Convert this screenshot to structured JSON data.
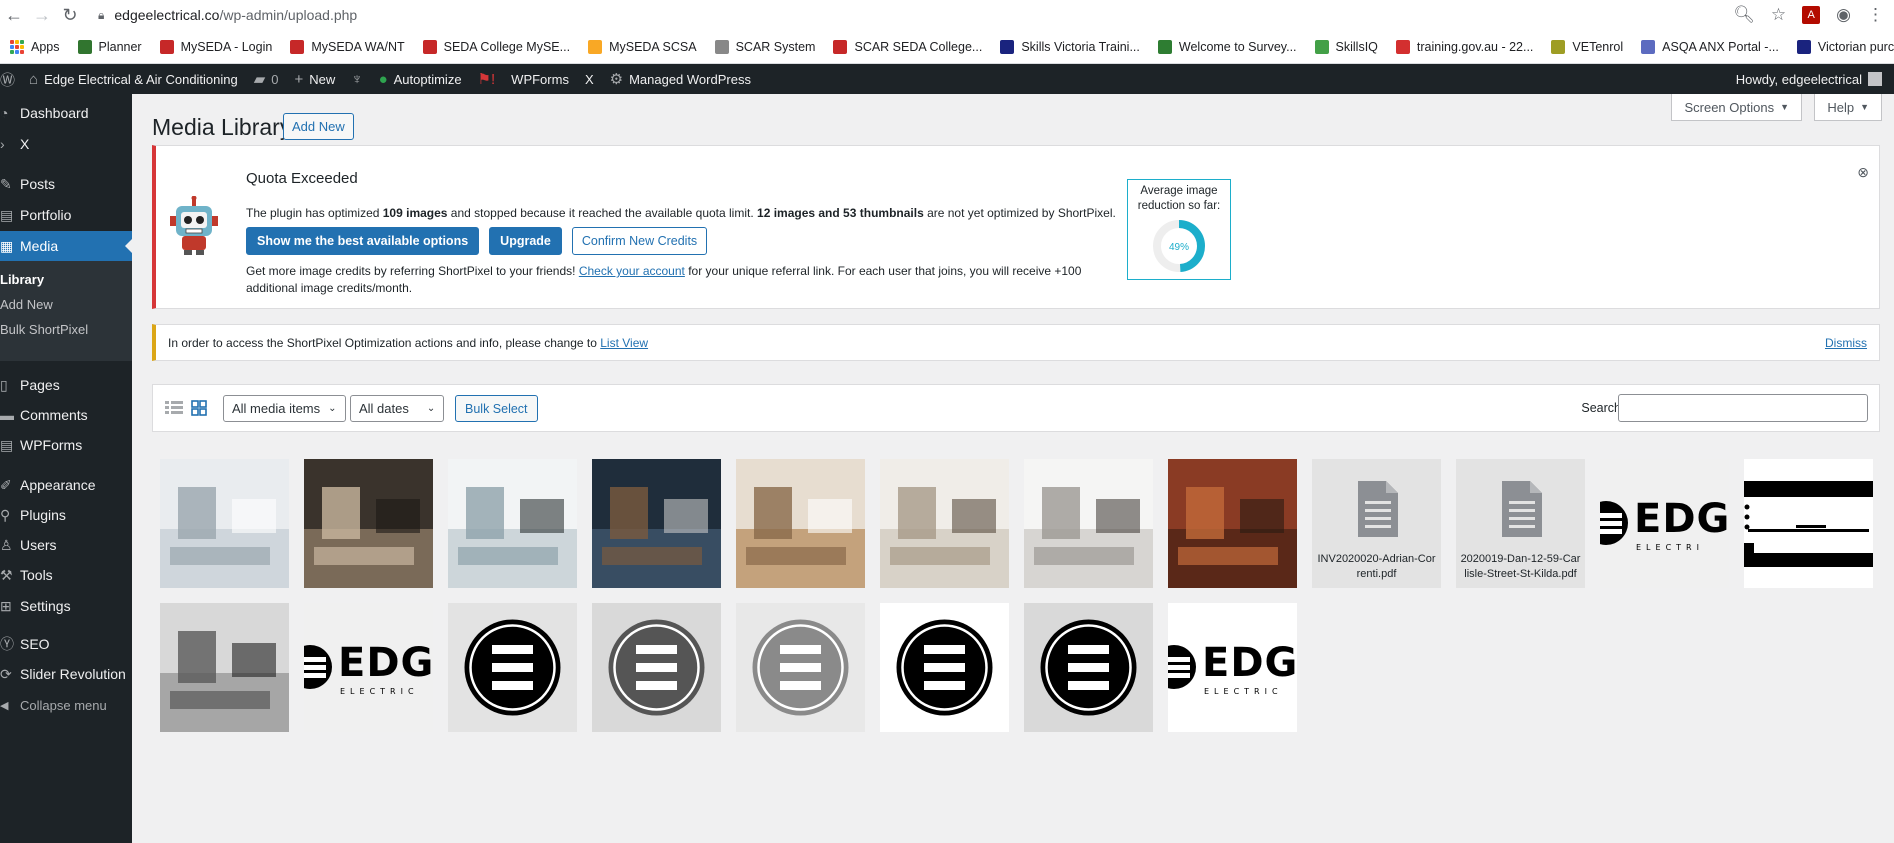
{
  "browser": {
    "url_host": "edgeelectrical.co",
    "url_path": "/wp-admin/upload.php"
  },
  "bookmarks": [
    {
      "label": "Apps",
      "color": "#1a73e8"
    },
    {
      "label": "Planner",
      "color": "#31752f"
    },
    {
      "label": "MySEDA - Login",
      "color": "#c62828"
    },
    {
      "label": "MySEDA WA/NT",
      "color": "#c62828"
    },
    {
      "label": "SEDA College MySE...",
      "color": "#c62828"
    },
    {
      "label": "MySEDA SCSA",
      "color": "#f9a825"
    },
    {
      "label": "SCAR System",
      "color": "#888888"
    },
    {
      "label": "SCAR SEDA College...",
      "color": "#c62828"
    },
    {
      "label": "Skills Victoria Traini...",
      "color": "#1a237e"
    },
    {
      "label": "Welcome to Survey...",
      "color": "#2e7d32"
    },
    {
      "label": "SkillsIQ",
      "color": "#43a047"
    },
    {
      "label": "training.gov.au - 22...",
      "color": "#d32f2f"
    },
    {
      "label": "VETenrol",
      "color": "#9e9d24"
    },
    {
      "label": "ASQA ANX Portal -...",
      "color": "#5c6bc0"
    },
    {
      "label": "Victorian purchasin...",
      "color": "#1a237e"
    }
  ],
  "adminbar": {
    "site_name": "Edge Electrical & Air Conditioning",
    "comments_count": "0",
    "new_label": "New",
    "autoptimize_label": "Autoptimize",
    "wpforms_label": "WPForms",
    "x_label": "X",
    "managed_label": "Managed WordPress",
    "howdy": "Howdy, edgeelectrical"
  },
  "sidebar": {
    "items": [
      {
        "label": "Dashboard",
        "icon": "dashboard-icon"
      },
      {
        "label": "X",
        "icon": "chevron-right-icon"
      },
      {
        "label": "Posts",
        "icon": "pin-icon"
      },
      {
        "label": "Portfolio",
        "icon": "portfolio-icon"
      },
      {
        "label": "Media",
        "icon": "media-icon"
      },
      {
        "label": "Pages",
        "icon": "page-icon"
      },
      {
        "label": "Comments",
        "icon": "comment-icon"
      },
      {
        "label": "WPForms",
        "icon": "forms-icon"
      },
      {
        "label": "Appearance",
        "icon": "brush-icon"
      },
      {
        "label": "Plugins",
        "icon": "plugin-icon"
      },
      {
        "label": "Users",
        "icon": "user-icon"
      },
      {
        "label": "Tools",
        "icon": "wrench-icon"
      },
      {
        "label": "Settings",
        "icon": "settings-icon"
      },
      {
        "label": "SEO",
        "icon": "seo-icon"
      },
      {
        "label": "Slider Revolution",
        "icon": "refresh-icon"
      }
    ],
    "submenu": [
      "Library",
      "Add New",
      "Bulk ShortPixel"
    ],
    "collapse": "Collapse menu"
  },
  "header": {
    "title": "Media Library",
    "add_new": "Add New",
    "screen_options": "Screen Options",
    "help": "Help"
  },
  "quota_notice": {
    "title": "Quota Exceeded",
    "text_1": "The plugin has optimized ",
    "text_2": "109 images",
    "text_3": " and stopped because it reached the available quota limit. ",
    "text_4": "12 images and 53 thumbnails",
    "text_5": " are not yet optimized by ShortPixel.",
    "btn_best": "Show me the best available options",
    "btn_upgrade": "Upgrade",
    "btn_confirm": "Confirm New Credits",
    "ref_1": "Get more image credits by referring ShortPixel to your friends! ",
    "ref_link": "Check your account",
    "ref_2": " for your unique referral link. For each user that joins, you will receive +100 additional image credits/month.",
    "avg_label": "Average image reduction so far:",
    "avg_value": "49%",
    "avg_fraction": 0.49,
    "accent": "#1caecb"
  },
  "list_notice": {
    "text": "In order to access the ShortPixel Optimization actions and info, please change to ",
    "link": "List View",
    "dismiss": "Dismiss"
  },
  "toolbar": {
    "filter_type": "All media items",
    "filter_date": "All dates",
    "bulk_select": "Bulk Select",
    "search_label": "Search"
  },
  "media": [
    {
      "kind": "photo",
      "desc": "bathroom"
    },
    {
      "kind": "photo",
      "desc": "kitchen-staff"
    },
    {
      "kind": "photo",
      "desc": "office-meeting-room"
    },
    {
      "kind": "photo",
      "desc": "dining-blue-wall"
    },
    {
      "kind": "photo",
      "desc": "living-room"
    },
    {
      "kind": "photo",
      "desc": "lounge-white"
    },
    {
      "kind": "photo",
      "desc": "white-kitchen"
    },
    {
      "kind": "photo",
      "desc": "brick-restaurant"
    },
    {
      "kind": "file",
      "filename": "INV2020020-Adrian-Correnti.pdf"
    },
    {
      "kind": "file",
      "filename": "2020019-Dan-12-59-Carlisle-Street-St-Kilda.pdf"
    },
    {
      "kind": "logo-text",
      "logo_text": "EDG",
      "logo_sub": "ELECTRI"
    },
    {
      "kind": "logo-crop"
    },
    {
      "kind": "photo",
      "desc": "family-portrait"
    },
    {
      "kind": "logo-text",
      "logo_text": "EDG",
      "logo_sub": "ELECTRIC"
    },
    {
      "kind": "logo-circle",
      "fill": "#000000",
      "bg": "#e3e3e3"
    },
    {
      "kind": "logo-circle",
      "fill": "#555555",
      "bg": "#d9d9d9"
    },
    {
      "kind": "logo-circle",
      "fill": "#8a8a8a",
      "bg": "#e8e8e8"
    },
    {
      "kind": "logo-circle",
      "fill": "#000000",
      "bg": "#ffffff"
    },
    {
      "kind": "logo-circle",
      "fill": "#000000",
      "bg": "#d9d9d9"
    },
    {
      "kind": "logo-text",
      "logo_text": "EDG",
      "logo_sub": "ELECTRIC",
      "bg": "#ffffff"
    }
  ]
}
